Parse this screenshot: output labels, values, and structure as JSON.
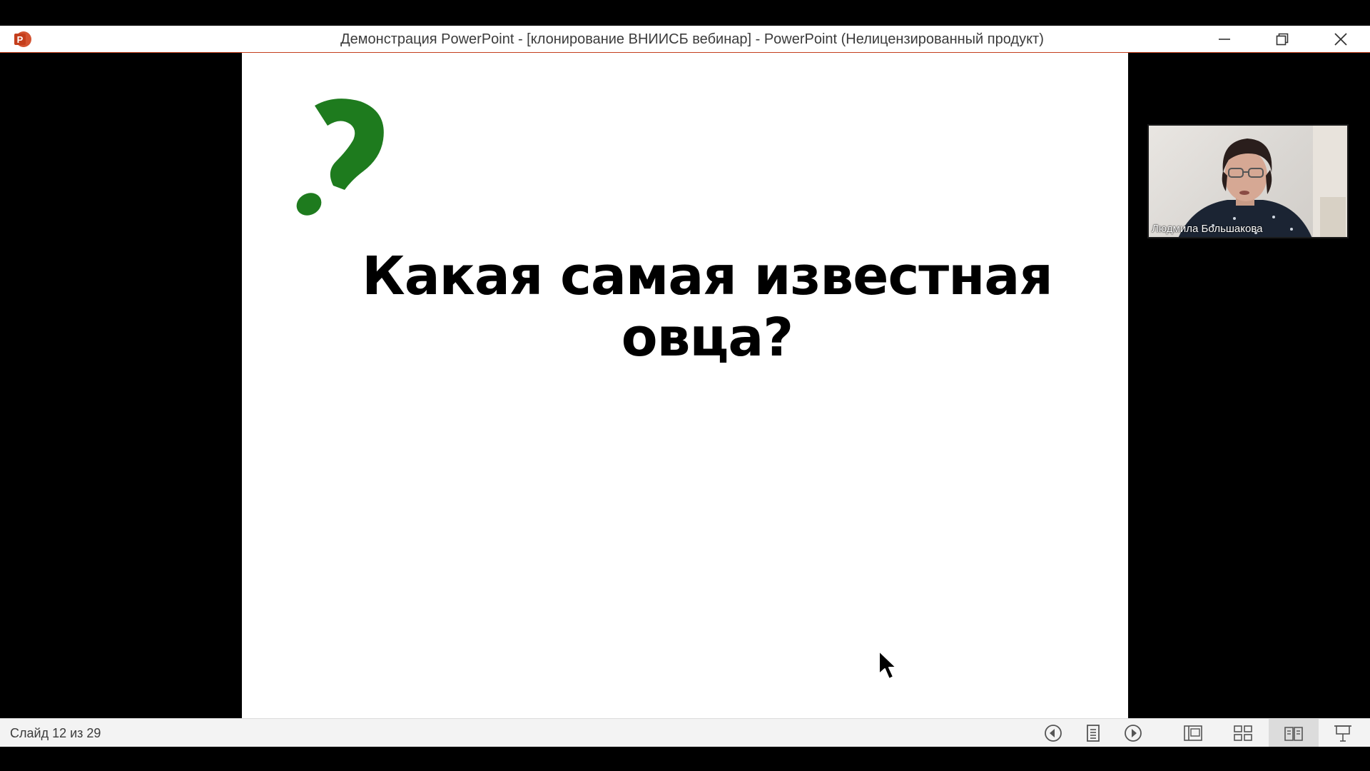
{
  "window": {
    "title": "Демонстрация PowerPoint - [клонирование ВНИИСБ вебинар] - PowerPoint (Нелицензированный продукт)",
    "app_icon": "powerpoint-icon",
    "controls": [
      "minimize-icon",
      "restore-icon",
      "close-icon"
    ]
  },
  "slide": {
    "title": "Какая самая известная овца?",
    "question_mark_color": "#1e7b1e"
  },
  "video": {
    "participant_name": "Людмила Большакова"
  },
  "status": {
    "slide_counter": "Слайд 12 из 29",
    "buttons": [
      "previous-icon",
      "notes-icon",
      "next-icon",
      "normal-view-icon",
      "slide-sorter-icon",
      "reading-view-icon",
      "slideshow-icon"
    ]
  },
  "colors": {
    "accent": "#c43e1c",
    "slide_bg": "#ffffff",
    "frame_bg": "#000000"
  }
}
